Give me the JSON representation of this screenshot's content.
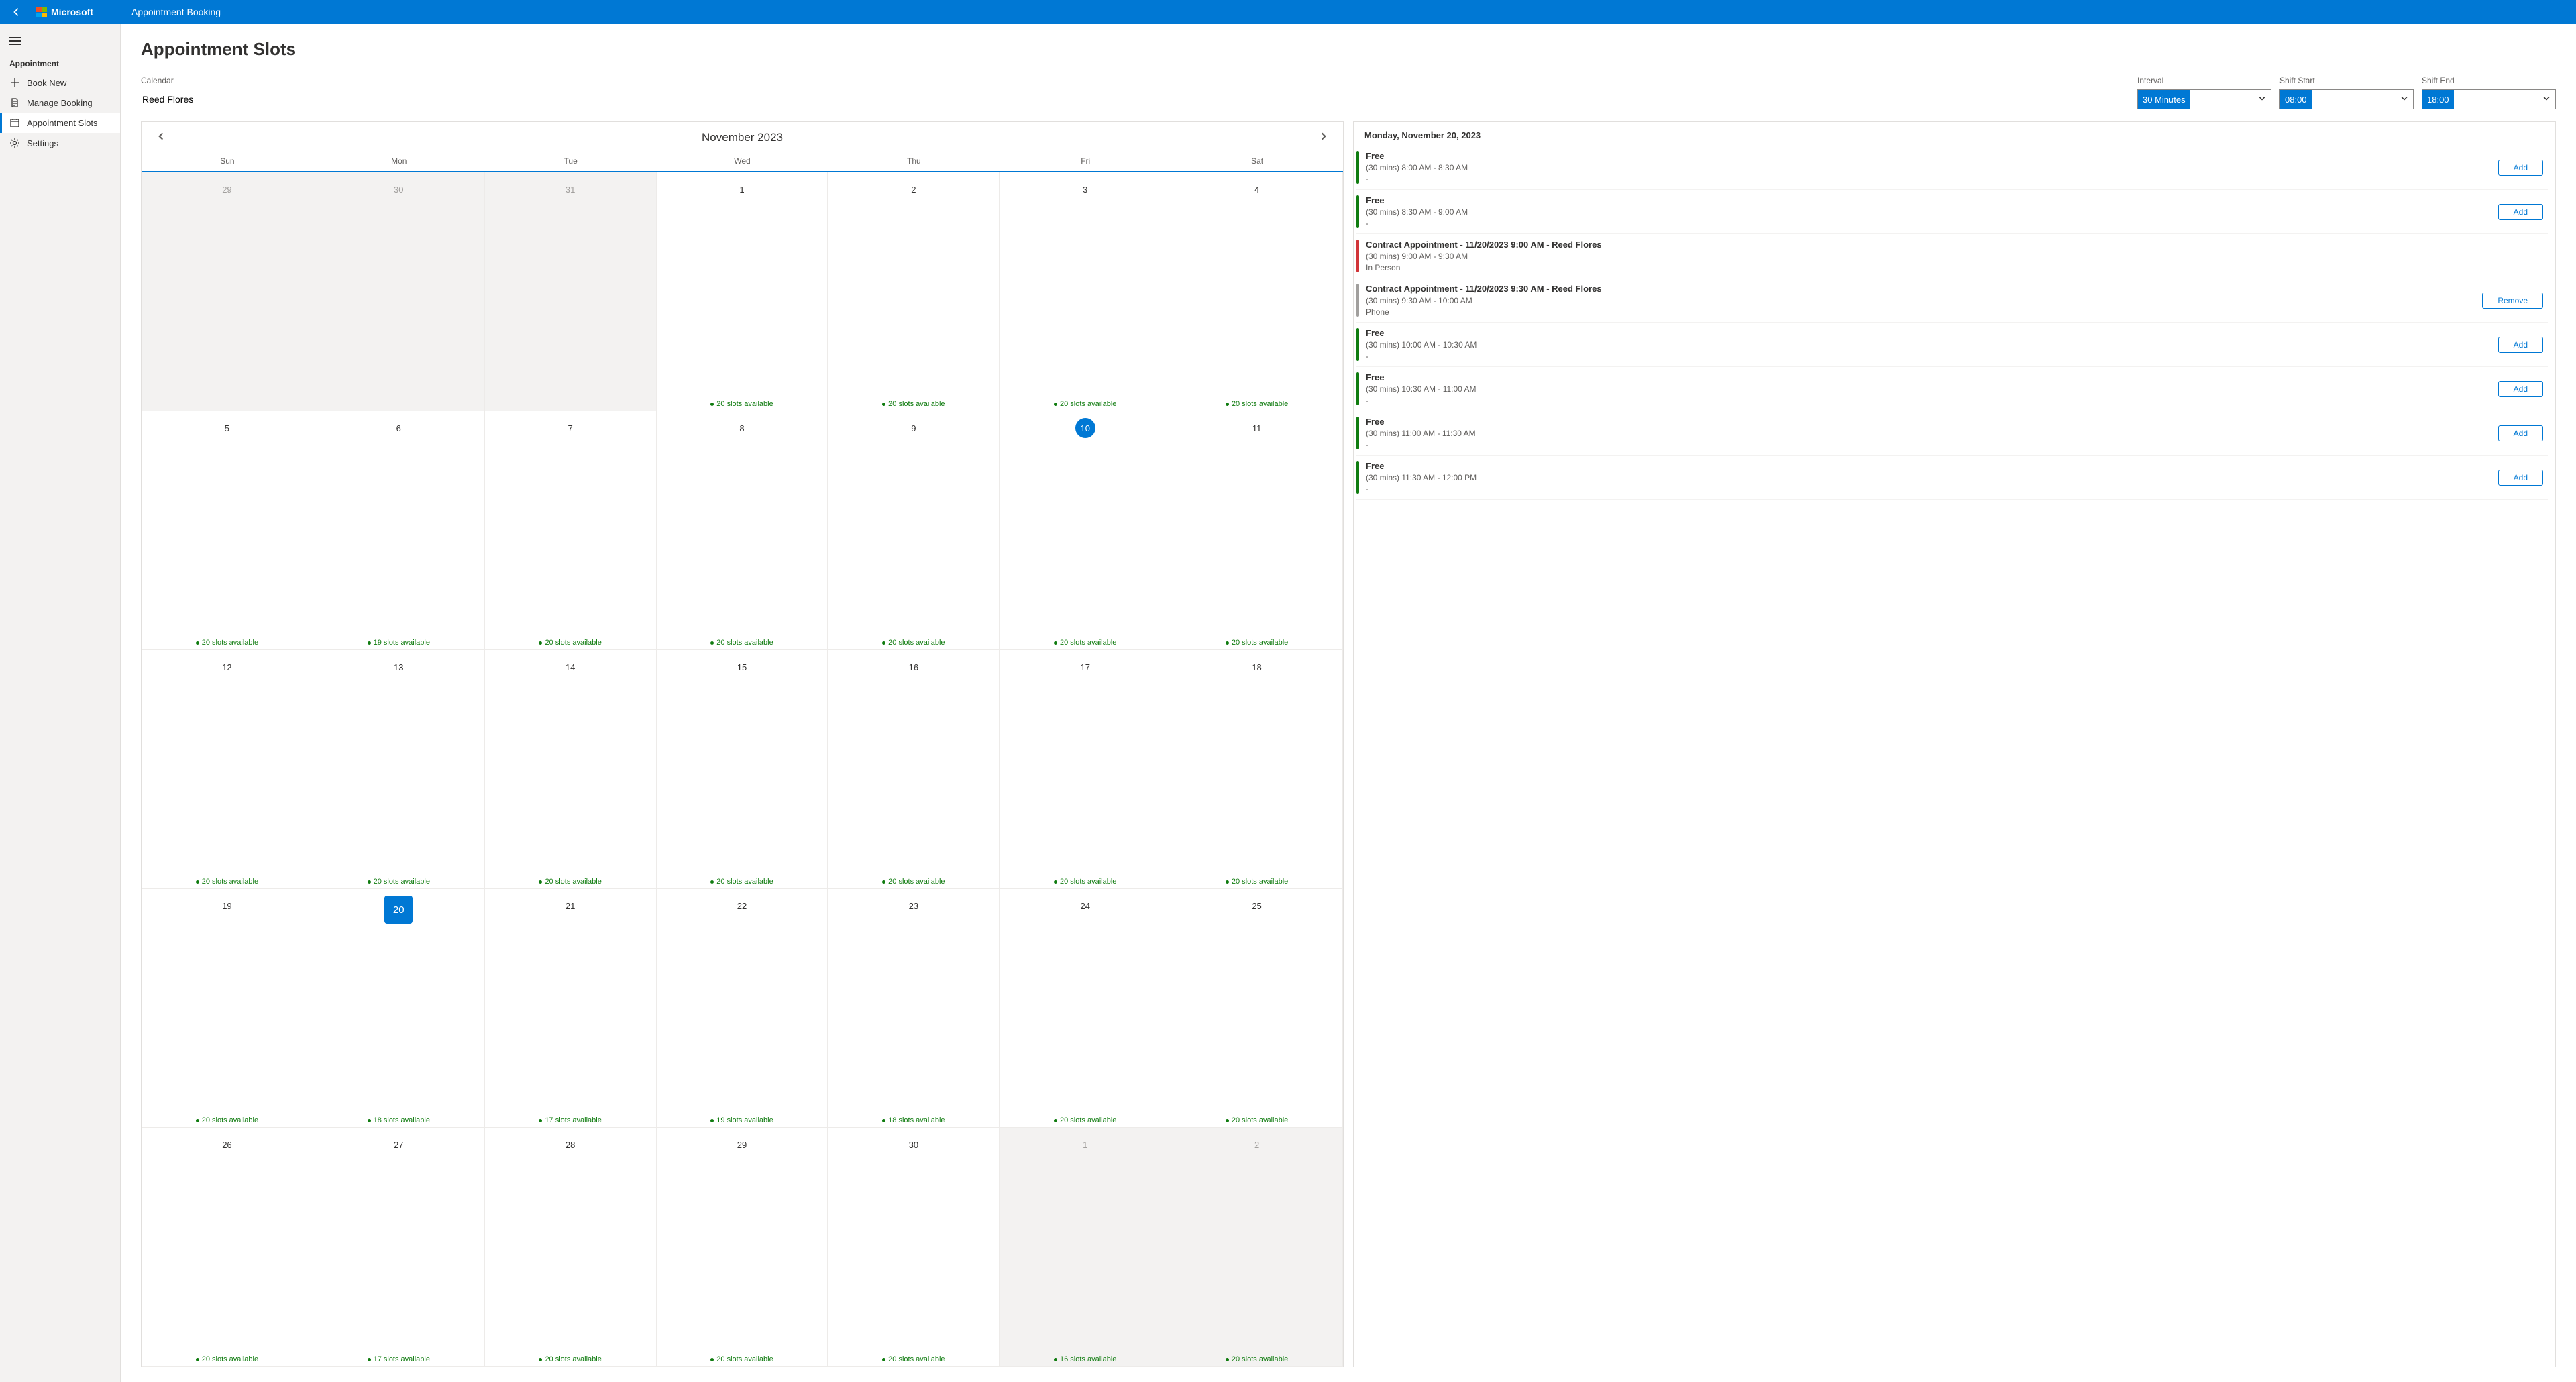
{
  "header": {
    "brand": "Microsoft",
    "app_title": "Appointment Booking"
  },
  "sidebar": {
    "section": "Appointment",
    "items": [
      {
        "label": "Book New",
        "icon": "plus"
      },
      {
        "label": "Manage Booking",
        "icon": "doc"
      },
      {
        "label": "Appointment Slots",
        "icon": "calendar",
        "active": true
      },
      {
        "label": "Settings",
        "icon": "gear"
      }
    ]
  },
  "page": {
    "title": "Appointment Slots",
    "calendar_label": "Calendar",
    "calendar_value": "Reed Flores",
    "interval_label": "Interval",
    "interval_value": "30 Minutes",
    "shift_start_label": "Shift Start",
    "shift_start_value": "08:00",
    "shift_end_label": "Shift End",
    "shift_end_value": "18:00"
  },
  "calendar": {
    "month_label": "November 2023",
    "days_of_week": [
      "Sun",
      "Mon",
      "Tue",
      "Wed",
      "Thu",
      "Fri",
      "Sat"
    ],
    "cells": [
      {
        "num": "29",
        "outside": true
      },
      {
        "num": "30",
        "outside": true
      },
      {
        "num": "31",
        "outside": true
      },
      {
        "num": "1",
        "slots": "20 slots available"
      },
      {
        "num": "2",
        "slots": "20 slots available"
      },
      {
        "num": "3",
        "slots": "20 slots available"
      },
      {
        "num": "4",
        "slots": "20 slots available"
      },
      {
        "num": "5",
        "slots": "20 slots available"
      },
      {
        "num": "6",
        "slots": "19 slots available"
      },
      {
        "num": "7",
        "slots": "20 slots available"
      },
      {
        "num": "8",
        "slots": "20 slots available"
      },
      {
        "num": "9",
        "slots": "20 slots available"
      },
      {
        "num": "10",
        "slots": "20 slots available",
        "today": true
      },
      {
        "num": "11",
        "slots": "20 slots available"
      },
      {
        "num": "12",
        "slots": "20 slots available"
      },
      {
        "num": "13",
        "slots": "20 slots available"
      },
      {
        "num": "14",
        "slots": "20 slots available"
      },
      {
        "num": "15",
        "slots": "20 slots available"
      },
      {
        "num": "16",
        "slots": "20 slots available"
      },
      {
        "num": "17",
        "slots": "20 slots available"
      },
      {
        "num": "18",
        "slots": "20 slots available"
      },
      {
        "num": "19",
        "slots": "20 slots available"
      },
      {
        "num": "20",
        "slots": "18 slots available",
        "selected": true
      },
      {
        "num": "21",
        "slots": "17 slots available"
      },
      {
        "num": "22",
        "slots": "19 slots available"
      },
      {
        "num": "23",
        "slots": "18 slots available"
      },
      {
        "num": "24",
        "slots": "20 slots available"
      },
      {
        "num": "25",
        "slots": "20 slots available"
      },
      {
        "num": "26",
        "slots": "20 slots available"
      },
      {
        "num": "27",
        "slots": "17 slots available"
      },
      {
        "num": "28",
        "slots": "20 slots available"
      },
      {
        "num": "29",
        "slots": "20 slots available"
      },
      {
        "num": "30",
        "slots": "20 slots available"
      },
      {
        "num": "1",
        "outside": true,
        "slots": "16 slots available"
      },
      {
        "num": "2",
        "outside": true,
        "slots": "20 slots available"
      }
    ]
  },
  "slot_panel": {
    "date_label": "Monday, November 20, 2023",
    "add_label": "Add",
    "remove_label": "Remove",
    "slots": [
      {
        "status": "free",
        "title": "Free",
        "time": "(30 mins) 8:00 AM - 8:30 AM",
        "mode": "-",
        "action": "add"
      },
      {
        "status": "free",
        "title": "Free",
        "time": "(30 mins) 8:30 AM - 9:00 AM",
        "mode": "-",
        "action": "add"
      },
      {
        "status": "booked",
        "title": "Contract Appointment - 11/20/2023 9:00 AM  - Reed Flores",
        "time": "(30 mins) 9:00 AM - 9:30 AM",
        "mode": "In Person",
        "action": ""
      },
      {
        "status": "phone",
        "title": "Contract Appointment - 11/20/2023 9:30 AM  - Reed Flores",
        "time": "(30 mins) 9:30 AM - 10:00 AM",
        "mode": "Phone",
        "action": "remove"
      },
      {
        "status": "free",
        "title": "Free",
        "time": "(30 mins) 10:00 AM - 10:30 AM",
        "mode": "-",
        "action": "add"
      },
      {
        "status": "free",
        "title": "Free",
        "time": "(30 mins) 10:30 AM - 11:00 AM",
        "mode": "-",
        "action": "add"
      },
      {
        "status": "free",
        "title": "Free",
        "time": "(30 mins) 11:00 AM - 11:30 AM",
        "mode": "-",
        "action": "add"
      },
      {
        "status": "free",
        "title": "Free",
        "time": "(30 mins) 11:30 AM - 12:00 PM",
        "mode": "-",
        "action": "add"
      }
    ]
  }
}
